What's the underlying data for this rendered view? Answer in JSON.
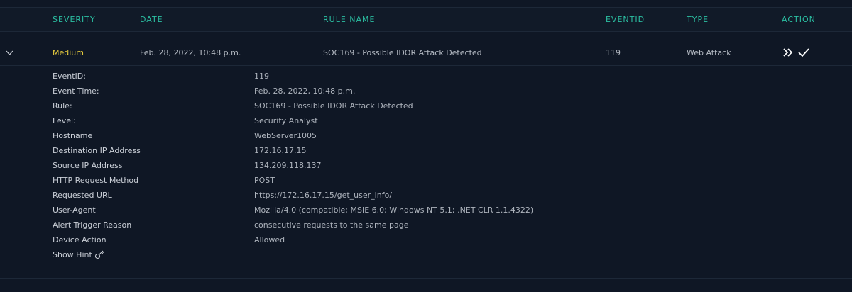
{
  "table": {
    "headers": {
      "severity": "SEVERITY",
      "date": "DATE",
      "rule_name": "RULE NAME",
      "eventid": "EVENTID",
      "type": "TYPE",
      "action": "ACTION"
    },
    "row": {
      "severity": "Medium",
      "date": "Feb. 28, 2022, 10:48 p.m.",
      "rule_name": "SOC169 - Possible IDOR Attack Detected",
      "eventid": "119",
      "type": "Web Attack"
    }
  },
  "details": {
    "fields": [
      {
        "label": "EventID:",
        "value": "119"
      },
      {
        "label": "Event Time:",
        "value": "Feb. 28, 2022, 10:48 p.m."
      },
      {
        "label": "Rule:",
        "value": "SOC169 - Possible IDOR Attack Detected"
      },
      {
        "label": "Level:",
        "value": "Security Analyst"
      },
      {
        "label": "Hostname",
        "value": "WebServer1005"
      },
      {
        "label": "Destination IP Address",
        "value": "172.16.17.15"
      },
      {
        "label": "Source IP Address",
        "value": "134.209.118.137"
      },
      {
        "label": "HTTP Request Method",
        "value": "POST"
      },
      {
        "label": "Requested URL",
        "value": "https://172.16.17.15/get_user_info/"
      },
      {
        "label": "User-Agent",
        "value": "Mozilla/4.0 (compatible; MSIE 6.0; Windows NT 5.1; .NET CLR 1.1.4322)"
      },
      {
        "label": "Alert Trigger Reason",
        "value": "consecutive requests to the same page"
      },
      {
        "label": "Device Action",
        "value": "Allowed"
      }
    ],
    "show_hint": "Show Hint"
  },
  "icons": {
    "expand": "chevron-down-icon",
    "escalate": "double-chevron-right-icon",
    "close": "checkmark-icon",
    "hint": "key-icon"
  },
  "colors": {
    "background": "#0f1725",
    "header_text": "#2bbfa2",
    "severity_medium": "#e8cc3e",
    "text": "#c7ccd4"
  }
}
